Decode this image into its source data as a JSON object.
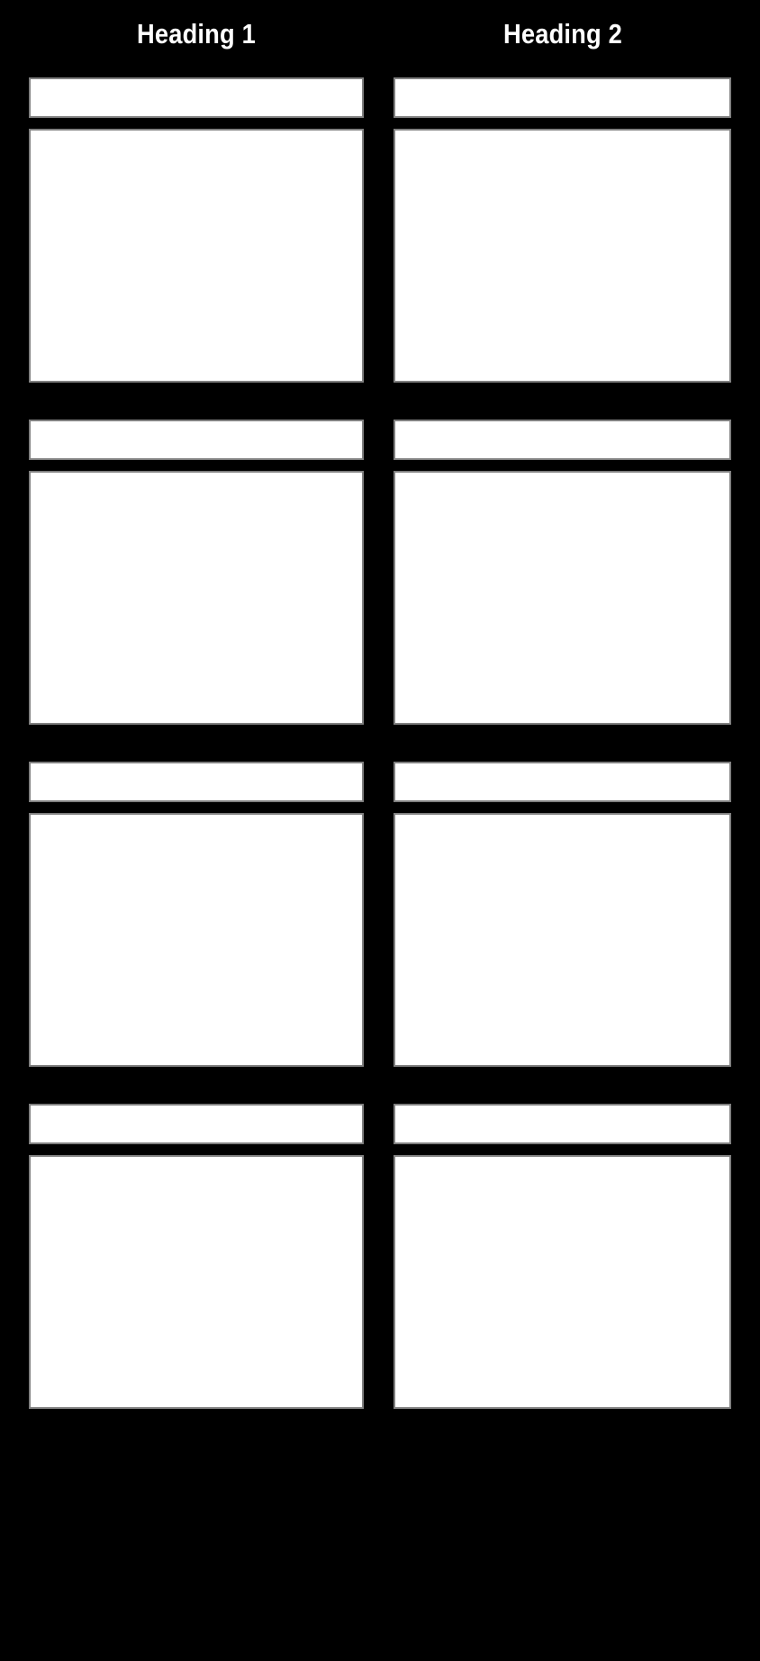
{
  "page": {
    "background_color": "#000000",
    "box_fill_color": "#ffffff",
    "box_border_color": "#808080",
    "heading_text_color": "#ffffff",
    "columns": 2,
    "rows": 4
  },
  "headings": [
    {
      "label": "Heading 1"
    },
    {
      "label": "Heading 2"
    }
  ],
  "cells": [
    {
      "id": "r1c1",
      "column": "Heading 1",
      "row": 1,
      "title": "",
      "body": ""
    },
    {
      "id": "r1c2",
      "column": "Heading 2",
      "row": 1,
      "title": "",
      "body": ""
    },
    {
      "id": "r2c1",
      "column": "Heading 1",
      "row": 2,
      "title": "",
      "body": ""
    },
    {
      "id": "r2c2",
      "column": "Heading 2",
      "row": 2,
      "title": "",
      "body": ""
    },
    {
      "id": "r3c1",
      "column": "Heading 1",
      "row": 3,
      "title": "",
      "body": ""
    },
    {
      "id": "r3c2",
      "column": "Heading 2",
      "row": 3,
      "title": "",
      "body": ""
    },
    {
      "id": "r4c1",
      "column": "Heading 1",
      "row": 4,
      "title": "",
      "body": ""
    },
    {
      "id": "r4c2",
      "column": "Heading 2",
      "row": 4,
      "title": "",
      "body": ""
    }
  ]
}
